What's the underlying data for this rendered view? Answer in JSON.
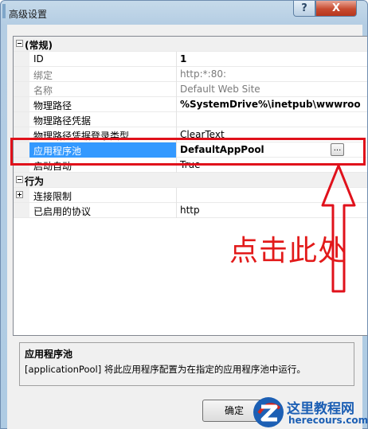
{
  "window": {
    "title": "高级设置",
    "help_label": "?",
    "close_label": "X"
  },
  "grid": {
    "categories": [
      {
        "label": "(常规)",
        "properties": [
          {
            "name": "ID",
            "value": "1",
            "value_style": "bold"
          },
          {
            "name": "绑定",
            "value": "http:*:80:",
            "value_style": "gray"
          },
          {
            "name": "名称",
            "value": "Default Web Site",
            "value_style": "gray"
          },
          {
            "name": "物理路径",
            "value": "%SystemDrive%\\inetpub\\wwwroo",
            "value_style": "bold"
          },
          {
            "name": "物理路径凭据",
            "value": ""
          },
          {
            "name": "物理路径凭据登录类型",
            "value": "ClearText"
          },
          {
            "name": "应用程序池",
            "value": "DefaultAppPool",
            "value_style": "bold",
            "selected": true,
            "button_label": "..."
          },
          {
            "name": "启动自动",
            "value": "True"
          }
        ]
      },
      {
        "label": "行为",
        "properties": [
          {
            "name": "连接限制",
            "value": "",
            "collapsed": true
          },
          {
            "name": "已启用的协议",
            "value": "http"
          }
        ]
      }
    ]
  },
  "description": {
    "title": "应用程序池",
    "text": "[applicationPool] 将此应用程序配置为在指定的应用程序池中运行。"
  },
  "buttons": {
    "ok_label": "确定"
  },
  "annotation": {
    "text": "点击此处",
    "color": "#e21a1a"
  },
  "watermark": {
    "title": "这里教程网",
    "url": "herecours.com"
  },
  "colors": {
    "selection": "#3399ff",
    "annotation_red": "#e0111b"
  }
}
